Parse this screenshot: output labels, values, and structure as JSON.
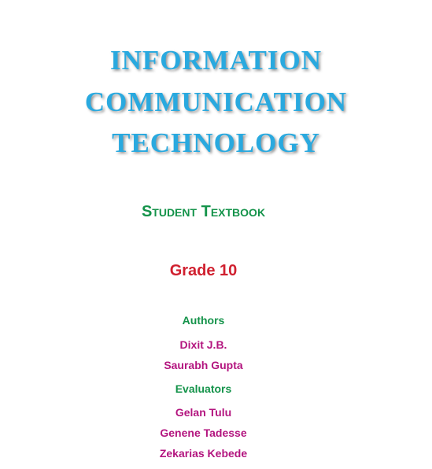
{
  "title": {
    "line1": "INFORMATION",
    "line2": "COMMUNICATION",
    "line3": "TECHNOLOGY"
  },
  "subtitle": "Student Textbook",
  "grade": "Grade 10",
  "authors": {
    "heading": "Authors",
    "names": [
      "Dixit J.B.",
      "Saurabh Gupta"
    ]
  },
  "evaluators": {
    "heading": "Evaluators",
    "names": [
      "Gelan Tulu",
      "Genene Tadesse",
      "Zekarias Kebede"
    ]
  },
  "colors": {
    "title": "#29a9df",
    "subtitle": "#14934a",
    "grade": "#d0202f",
    "names": "#b3157f"
  }
}
